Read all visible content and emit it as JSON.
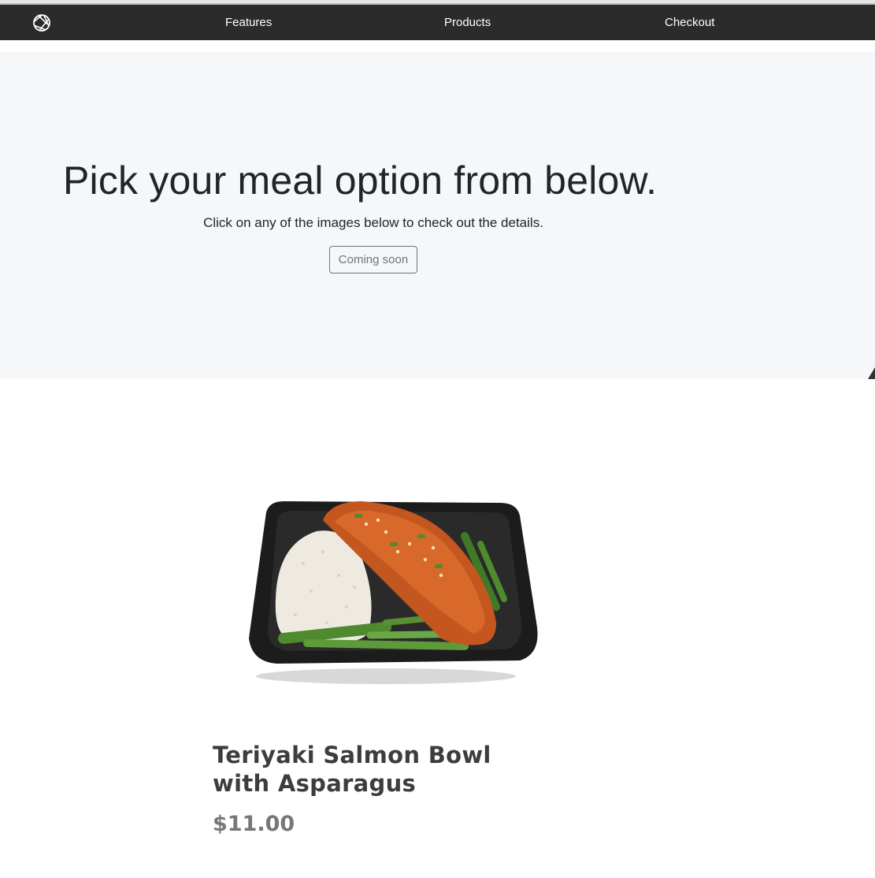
{
  "nav": {
    "logo_icon": "aperture-icon",
    "links": [
      {
        "label": "Features"
      },
      {
        "label": "Products"
      },
      {
        "label": "Checkout"
      }
    ]
  },
  "hero": {
    "title": "Pick your meal option from below.",
    "subtitle": "Click on any of the images below to check out the details.",
    "button_label": "Coming soon"
  },
  "product": {
    "name": "Teriyaki Salmon Bowl with Asparagus",
    "price": "$11.00",
    "image_icon": "salmon-bowl-image"
  },
  "colors": {
    "navbar": "#2b2b2b",
    "hero_bg": "#f6f7f8",
    "text_dark": "#212529",
    "button_outline": "#6c757d",
    "price": "#777777"
  }
}
